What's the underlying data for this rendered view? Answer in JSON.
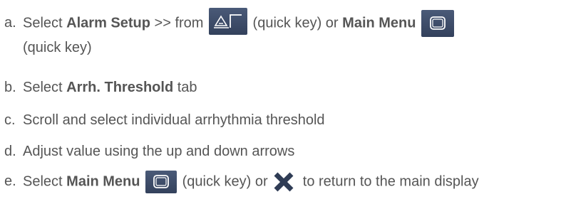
{
  "steps": [
    {
      "marker": "a.",
      "t1": "Select ",
      "b1": "Alarm Setup",
      "t2": " >> from ",
      "icon1": "alarm-setup-icon",
      "t3": " (quick key) or ",
      "b2": "Main Menu",
      "icon2": "main-menu-icon",
      "t4": "(quick key)"
    },
    {
      "marker": "b.",
      "t1": "Select ",
      "b1": "Arrh. Threshold",
      "t2": " tab"
    },
    {
      "marker": "c.",
      "t1": "Scroll and select individual arrhythmia threshold"
    },
    {
      "marker": "d.",
      "t1": "Adjust value using the up and down arrows"
    },
    {
      "marker": "e.",
      "t1": "Select ",
      "b1": "Main Menu",
      "icon1": "main-menu-icon",
      "t2": " (quick key) or ",
      "icon2": "close-icon",
      "t3": " to return to the main display"
    }
  ],
  "colors": {
    "text": "#555555",
    "key_bg": "#3b4a68",
    "key_icon": "#ffffff"
  }
}
